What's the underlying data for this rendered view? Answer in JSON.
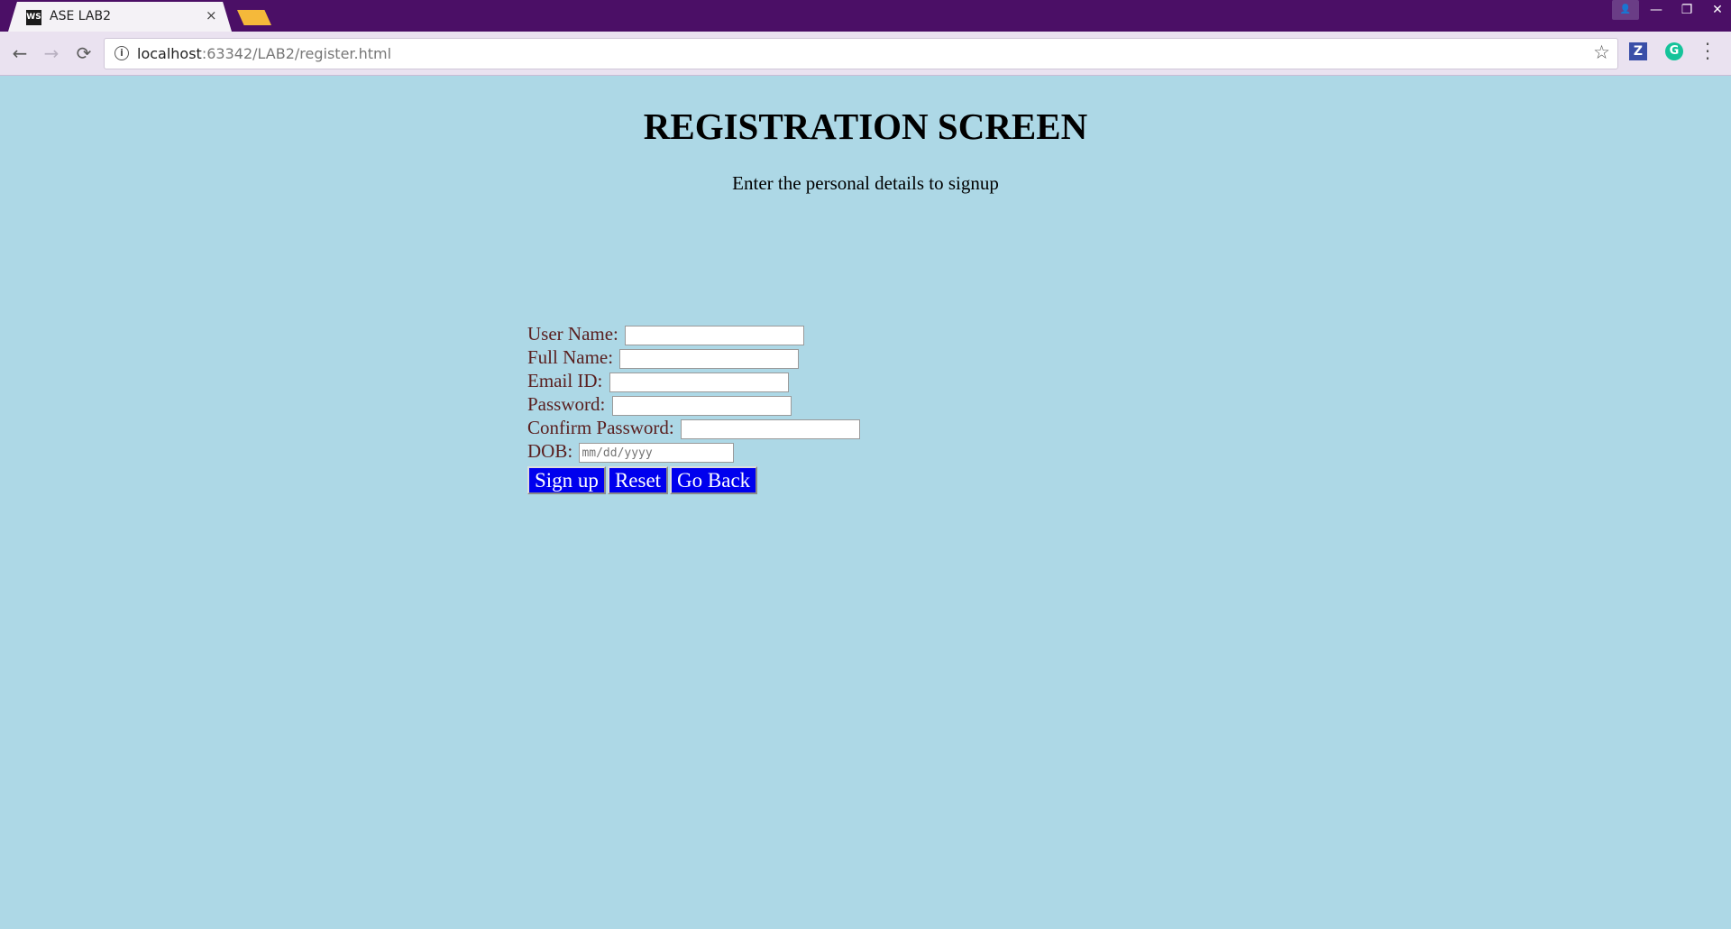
{
  "browser": {
    "tab_title": "ASE LAB2",
    "tab_favicon": "WS",
    "tab_close": "×",
    "url_host": "localhost",
    "url_rest": ":63342/LAB2/register.html",
    "window_controls": {
      "profile": "👤",
      "minimize": "—",
      "restore": "❐",
      "close": "✕"
    },
    "extensions": {
      "z_label": "Z",
      "g_label": "G"
    }
  },
  "page": {
    "title": "REGISTRATION SCREEN",
    "subtitle": "Enter the personal details to signup",
    "form": {
      "user_name_label": "User Name:",
      "full_name_label": "Full Name:",
      "email_label": "Email ID:",
      "password_label": "Password:",
      "confirm_password_label": "Confirm Password:",
      "dob_label": "DOB:",
      "dob_placeholder": "mm/dd/yyyy"
    },
    "buttons": {
      "signup": "Sign up",
      "reset": "Reset",
      "go_back": "Go Back"
    }
  },
  "colors": {
    "background": "#add8e6",
    "button": "#0000ee",
    "label": "#5a2020",
    "titlebar": "#4b0f66"
  }
}
